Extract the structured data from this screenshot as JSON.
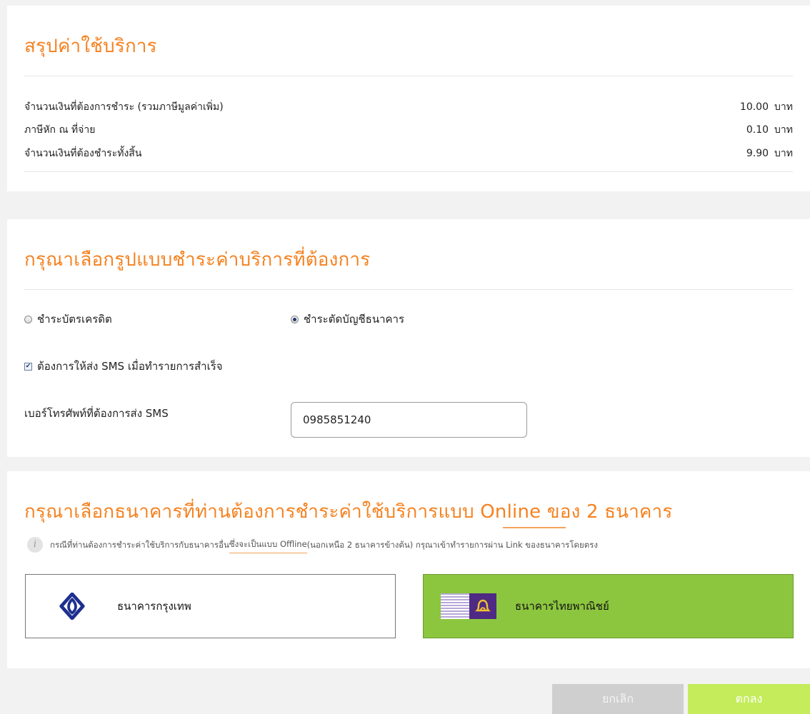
{
  "summary": {
    "title": "สรุปค่าใช้บริการ",
    "rows": [
      {
        "label": "จำนวนเงินที่ต้องการชำระ (รวมภาษีมูลค่าเพิ่ม)",
        "amount": "10.00",
        "unit": "บาท"
      },
      {
        "label": "ภาษีหัก ณ ที่จ่าย",
        "amount": "0.10",
        "unit": "บาท"
      },
      {
        "label": "จำนวนเงินที่ต้องชำระทั้งสิ้น",
        "amount": "9.90",
        "unit": "บาท"
      }
    ]
  },
  "payment_method": {
    "title": "กรุณาเลือกรูปแบบชำระค่าบริการที่ต้องการ",
    "options": [
      {
        "label": "ชำระบัตรเครดิต",
        "selected": false
      },
      {
        "label": "ชำระตัดบัญชีธนาคาร",
        "selected": true
      }
    ],
    "sms_checkbox_label": "ต้องการให้ส่ง SMS เมื่อทำรายการสำเร็จ",
    "sms_checked": true,
    "phone_label": "เบอร์โทรศัพท์ที่ต้องการส่ง SMS",
    "phone_value": "0985851240"
  },
  "bank_selection": {
    "title": "กรุณาเลือกธนาคารที่ท่านต้องการชำระค่าใช้บริการแบบ Online ของ 2 ธนาคาร",
    "info_icon": "i",
    "info_prefix": "กรณีที่ท่านต้องการชำระค่าใช้บริการกับธนาคารอื่น ",
    "info_link": "ซึ่งจะเป็นแบบ Offline",
    "info_suffix": " (นอกเหนือ 2 ธนาคารข้างต้น) กรุณาเข้าทำรายการผ่าน Link ของธนาคารโดยตรง",
    "banks": [
      {
        "name": "ธนาคารกรุงเทพ",
        "logo": "bangkok-bank-logo",
        "selected": false,
        "color": "#1e4598"
      },
      {
        "name": "ธนาคารไทยพาณิชย์",
        "logo": "scb-logo",
        "selected": true,
        "color": "#4e2a84"
      }
    ]
  },
  "actions": {
    "cancel_label": "ยกเลิก",
    "ok_label": "ตกลง"
  },
  "colors": {
    "accent": "#f58220",
    "selected_bank": "#8cc63f",
    "ok_button": "#c4ec5b",
    "cancel_button": "#cfcfcf"
  }
}
